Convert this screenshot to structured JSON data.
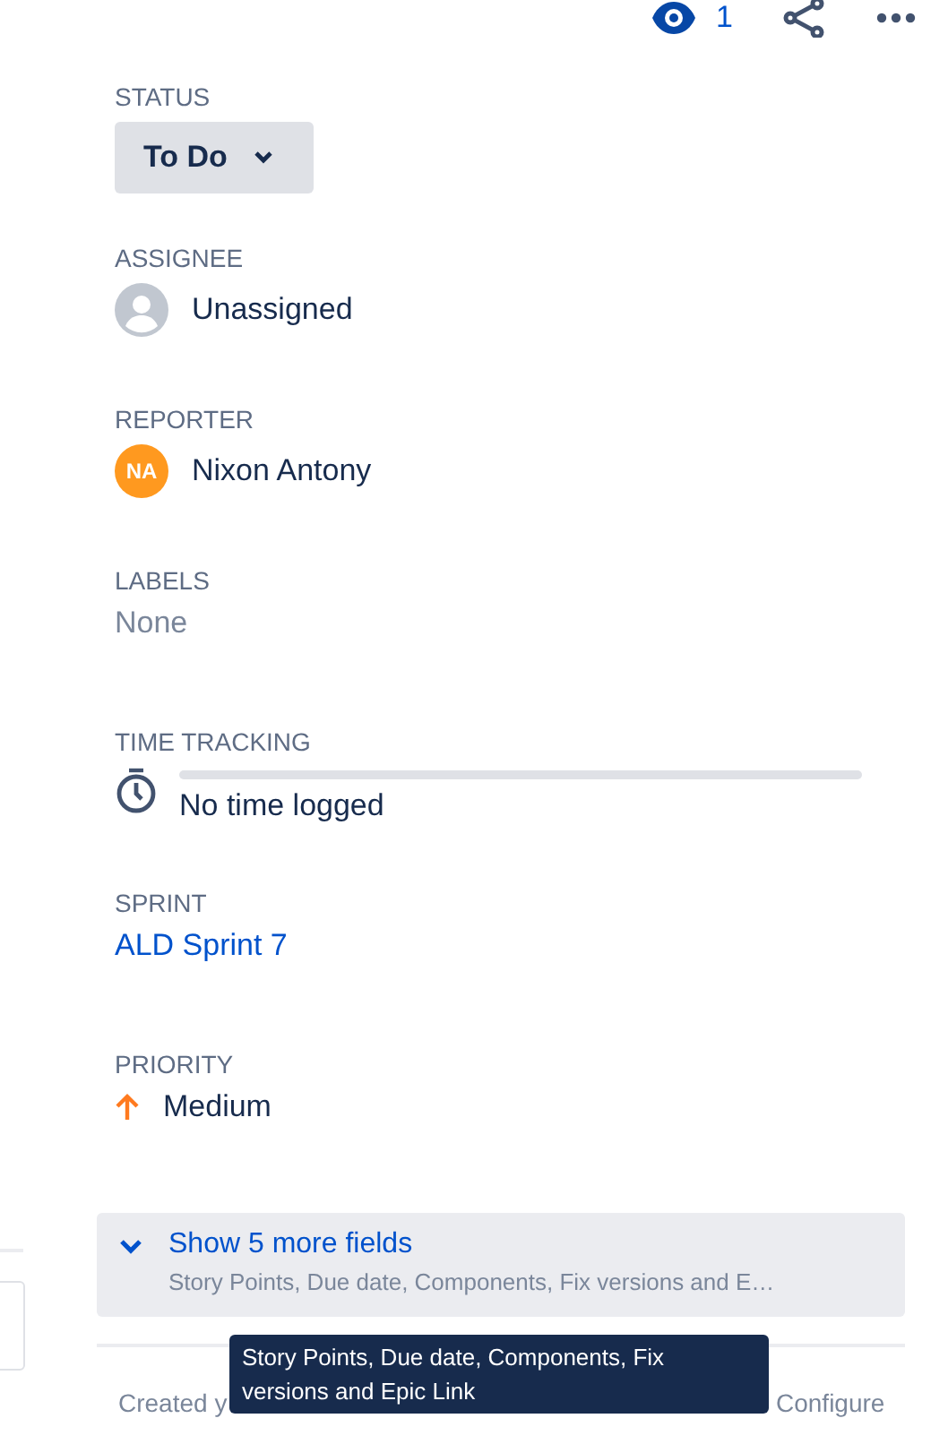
{
  "header": {
    "watchers": "1"
  },
  "fields": [
    {
      "kind": "status",
      "label": "STATUS",
      "value": "To Do"
    },
    {
      "kind": "unassigned",
      "label": "ASSIGNEE",
      "value": "Unassigned"
    },
    {
      "kind": "user",
      "label": "REPORTER",
      "value": "Nixon Antony",
      "initials": "NA",
      "color": "#ff991f"
    },
    {
      "kind": "empty",
      "label": "LABELS",
      "value": "None"
    },
    {
      "kind": "time",
      "label": "TIME TRACKING",
      "value": "No time logged",
      "level": 0
    },
    {
      "kind": "link",
      "label": "SPRINT",
      "value": "ALD Sprint 7"
    },
    {
      "kind": "priority",
      "label": "PRIORITY",
      "value": "Medium"
    }
  ],
  "more_fields": {
    "title": "Show 5 more fields",
    "summary": "Story Points, Due date, Components, Fix versions and E…",
    "expanded": false
  },
  "tooltip": "Story Points, Due date, Components, Fix versions and Epic Link",
  "footer": {
    "created": "Created y",
    "configure": "Configure"
  }
}
